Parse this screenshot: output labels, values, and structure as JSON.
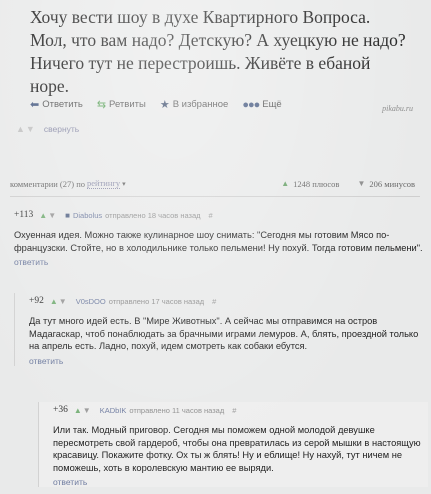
{
  "post": {
    "text": "Хочу вести шоу в духе Квартирного Вопроса. Мол, что вам надо? Детскую? А хуецкую не надо? Ничего тут не перестроишь. Живёте в ебаной норе.",
    "actions": {
      "reply": "Ответить",
      "retweets": "Ретвиты",
      "favorite": "В избранное",
      "more": "Ещё"
    },
    "watermark": "pikabu.ru",
    "collapse": "свернуть"
  },
  "comments_header": {
    "prefix": "комментарии (27) по",
    "sort": "рейтингу",
    "pluses": "1248 плюсов",
    "minuses": "206 минусов"
  },
  "comments": [
    {
      "score": "+113",
      "user": "Diabolus",
      "meta": "отправлено 18 часов назад",
      "hash": "#",
      "text": "Охуенная идея. Можно также кулинарное шоу снимать: \"Сегодня мы готовим Мясо по-французски. Стойте, но в холодильнике только пельмени! Ну похуй. Тогда готовим пельмени\".",
      "reply": "ответить"
    },
    {
      "score": "+92",
      "user": "V0sDOO",
      "meta": "отправлено 17 часов назад",
      "hash": "#",
      "text": "Да тут много идей есть. В \"Мире Животных\". А сейчас мы отправимся на остров Мадагаскар, чтоб понаблюдать за брачными играми лемуров. А, блять, проездной только на апрель есть. Ладно, похуй, идем смотреть как собаки ебутся.",
      "reply": "ответить"
    },
    {
      "score": "+36",
      "user": "KADbIK",
      "meta": "отправлено 11 часов назад",
      "hash": "#",
      "text": "Или так. Модный приговор. Сегодня мы поможем одной молодой девушке пересмотреть свой гардероб, чтобы она превратилась из серой мышки в настоящую красавицу. Покажите фотку. Ох ты ж блять! Ну и еблище! Ну нахуй, тут ничем не поможешь, хоть в королевскую мантию ее выряди.",
      "reply": "ответить"
    }
  ]
}
